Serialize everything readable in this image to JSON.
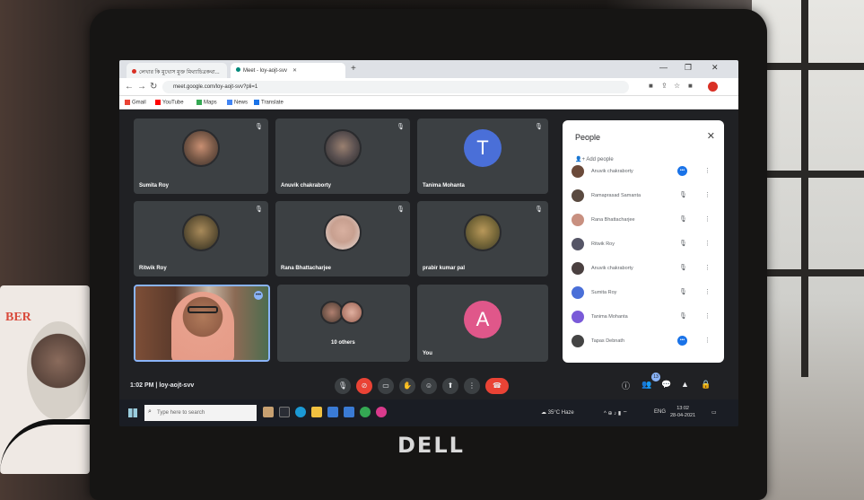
{
  "browser": {
    "tabs": [
      {
        "label": "লেখার কি মুখোস মুক্ত মিথ্যাচিত্রকথা...",
        "active": false
      },
      {
        "label": "Meet - loy-aojt-svv",
        "active": true
      }
    ],
    "url": "meet.google.com/loy-aojt-svv?pli=1",
    "bookmarks": [
      {
        "label": "Gmail",
        "color": "#ea4335"
      },
      {
        "label": "YouTube",
        "color": "#ff0000"
      },
      {
        "label": "Maps",
        "color": "#34a853"
      },
      {
        "label": "News",
        "color": "#4285f4"
      },
      {
        "label": "Translate",
        "color": "#1a73e8"
      }
    ]
  },
  "meet": {
    "tiles": [
      {
        "name": "Sumita Roy",
        "kind": "photo",
        "color": "#7a5a48"
      },
      {
        "name": "Anuvik chakraborty",
        "kind": "photo",
        "color": "#5a5050"
      },
      {
        "name": "Tanima Mohanta",
        "kind": "letter",
        "letter": "T",
        "color": "#4a6fd8"
      },
      {
        "name": "Ritwik Roy",
        "kind": "photo",
        "color": "#6b5a3a"
      },
      {
        "name": "Rana Bhattacharjee",
        "kind": "photo",
        "color": "#c8a090"
      },
      {
        "name": "prabir kumar pal",
        "kind": "photo",
        "color": "#7a6a3a"
      },
      {
        "name": "",
        "kind": "video"
      },
      {
        "name": "10 others",
        "kind": "others"
      },
      {
        "name": "You",
        "kind": "letter",
        "letter": "A",
        "color": "#e0578a"
      }
    ],
    "people_panel": {
      "title": "People",
      "add_label": "Add people",
      "participants": [
        {
          "name": "Anuvik chakraborty",
          "color": "#6b4a3a",
          "badge": true
        },
        {
          "name": "Ramaprasad Samanta",
          "color": "#5a4a40",
          "badge": false
        },
        {
          "name": "Rana Bhattacharjee",
          "color": "#c89080",
          "badge": false
        },
        {
          "name": "Ritwik Roy",
          "color": "#556",
          "badge": false
        },
        {
          "name": "Anuvik chakraborty",
          "color": "#4a4040",
          "badge": false
        },
        {
          "name": "Sumita Roy",
          "color": "#4a6fd8",
          "badge": false
        },
        {
          "name": "Tanima Mohanta",
          "color": "#7a5ad8",
          "badge": false
        },
        {
          "name": "Tapas Debnath",
          "color": "#444",
          "badge": true
        }
      ]
    },
    "meeting_time": "1:02 PM",
    "meeting_code": "loy-aojt-svv",
    "participant_count": "13"
  },
  "taskbar": {
    "search_placeholder": "Type here to search",
    "weather": "35°C Haze",
    "tray_lang": "ENG",
    "clock_time": "13:02",
    "clock_date": "28-04-2021"
  },
  "device": {
    "brand": "DELL"
  },
  "calendar": {
    "title": "BER"
  }
}
